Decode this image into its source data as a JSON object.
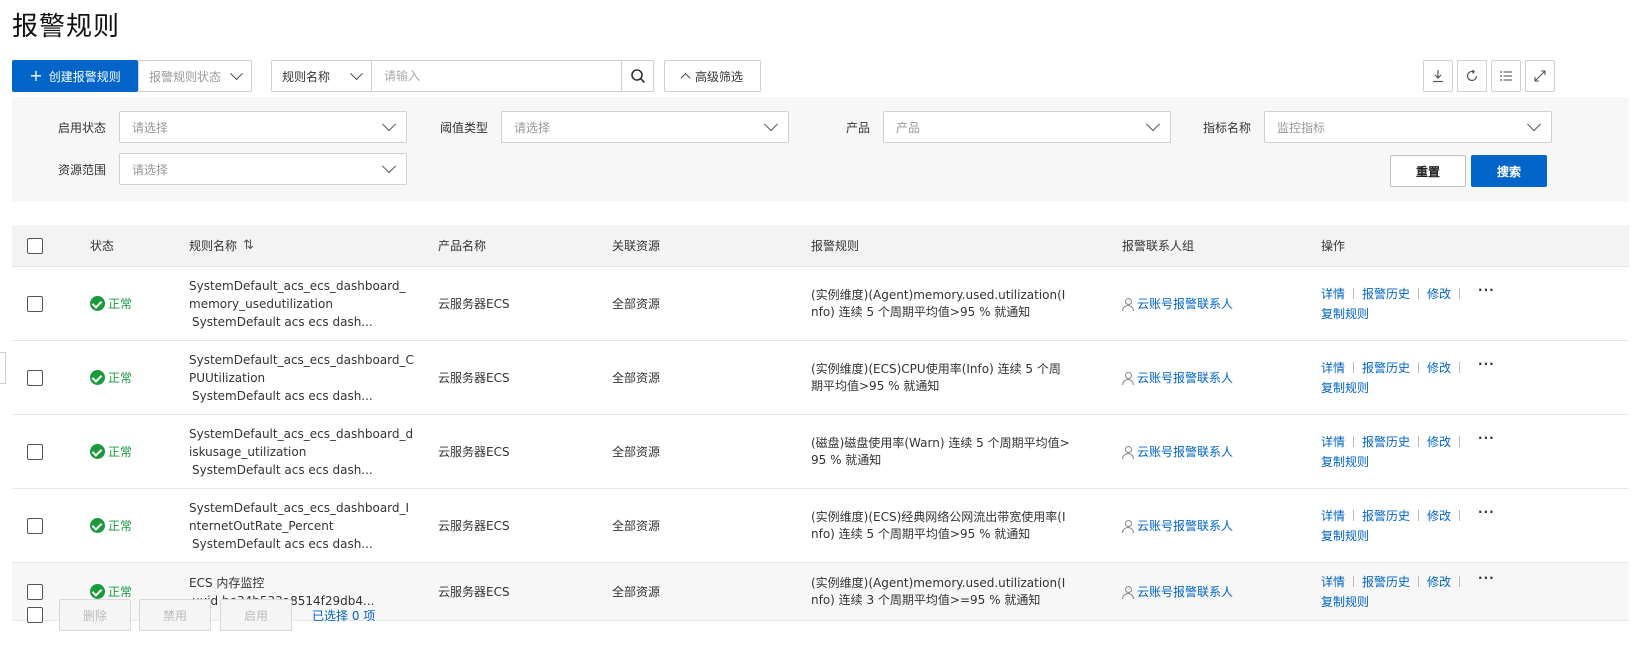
{
  "page": {
    "title": "报警规则"
  },
  "toolbar": {
    "create_label": "创建报警规则",
    "status_filter_placeholder": "报警规则状态",
    "search_field_select": "规则名称",
    "search_placeholder": "请输入",
    "advanced_label": "高级筛选",
    "icons": [
      "download-icon",
      "refresh-icon",
      "column-settings-icon",
      "fullscreen-icon"
    ]
  },
  "filters": {
    "enable_status": {
      "label": "启用状态",
      "placeholder": "请选择"
    },
    "threshold_type": {
      "label": "阈值类型",
      "placeholder": "请选择"
    },
    "product": {
      "label": "产品",
      "placeholder": "产品"
    },
    "metric_name": {
      "label": "指标名称",
      "placeholder": "监控指标"
    },
    "resource_scope": {
      "label": "资源范围",
      "placeholder": "请选择"
    },
    "reset_label": "重置",
    "search_label": "搜索"
  },
  "table": {
    "headers": {
      "status": "状态",
      "rule_name": "规则名称",
      "product": "产品名称",
      "resource": "关联资源",
      "rule": "报警规则",
      "contact": "报警联系人组",
      "ops": "操作"
    },
    "ops_labels": {
      "detail": "详情",
      "history": "报警历史",
      "edit": "修改",
      "more": "···",
      "copy": "复制规则"
    },
    "rows": [
      {
        "status": "正常",
        "name": "SystemDefault_acs_ecs_dashboard_memory_usedutilization",
        "sub": "SystemDefault acs ecs dash...",
        "product": "云服务器ECS",
        "resource": "全部资源",
        "rule": "(实例维度)(Agent)memory.used.utilization(Info) 连续 5 个周期平均值>95 % 就通知",
        "contact": "云账号报警联系人"
      },
      {
        "status": "正常",
        "name": "SystemDefault_acs_ecs_dashboard_CPUUtilization",
        "sub": "SystemDefault acs ecs dash...",
        "product": "云服务器ECS",
        "resource": "全部资源",
        "rule": "(实例维度)(ECS)CPU使用率(Info) 连续 5 个周期平均值>95 % 就通知",
        "contact": "云账号报警联系人"
      },
      {
        "status": "正常",
        "name": "SystemDefault_acs_ecs_dashboard_diskusage_utilization",
        "sub": "SystemDefault acs ecs dash...",
        "product": "云服务器ECS",
        "resource": "全部资源",
        "rule": "(磁盘)磁盘使用率(Warn) 连续 5 个周期平均值>95 % 就通知",
        "contact": "云账号报警联系人"
      },
      {
        "status": "正常",
        "name": "SystemDefault_acs_ecs_dashboard_InternetOutRate_Percent",
        "sub": "SystemDefault acs ecs dash...",
        "product": "云服务器ECS",
        "resource": "全部资源",
        "rule": "(实例维度)(ECS)经典网络公网流出带宽使用率(Info) 连续 5 个周期平均值>95 % 就通知",
        "contact": "云账号报警联系人"
      },
      {
        "status": "正常",
        "name": "ECS 内存监控",
        "sub": "uuid be34b533a8514f29db4...",
        "product": "云服务器ECS",
        "resource": "全部资源",
        "rule": "(实例维度)(Agent)memory.used.utilization(Info) 连续 3 个周期平均值>=95 % 就通知",
        "contact": "云账号报警联系人"
      }
    ]
  },
  "bottom": {
    "delete_label": "删除",
    "disable_label": "禁用",
    "enable_label": "启用",
    "selected_text": "已选择 0 项"
  }
}
